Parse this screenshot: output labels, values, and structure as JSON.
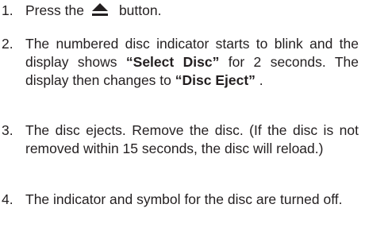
{
  "steps": [
    {
      "number": "1.",
      "before_icon": "Press the",
      "icon": "eject-icon",
      "after_icon": "button."
    },
    {
      "number": "2.",
      "text_a": "The numbered disc indicator starts to blink and the display shows ",
      "bold_a": "“Select Disc”",
      "text_b": " for 2 seconds. The display then changes to ",
      "bold_b": "“Disc Eject”",
      "text_c": " ."
    },
    {
      "number": "3.",
      "text": "The disc ejects. Remove the disc. (If the disc is not removed within 15 seconds, the disc will reload.)"
    },
    {
      "number": "4.",
      "text": "The indicator and symbol for the disc are turned off."
    }
  ]
}
